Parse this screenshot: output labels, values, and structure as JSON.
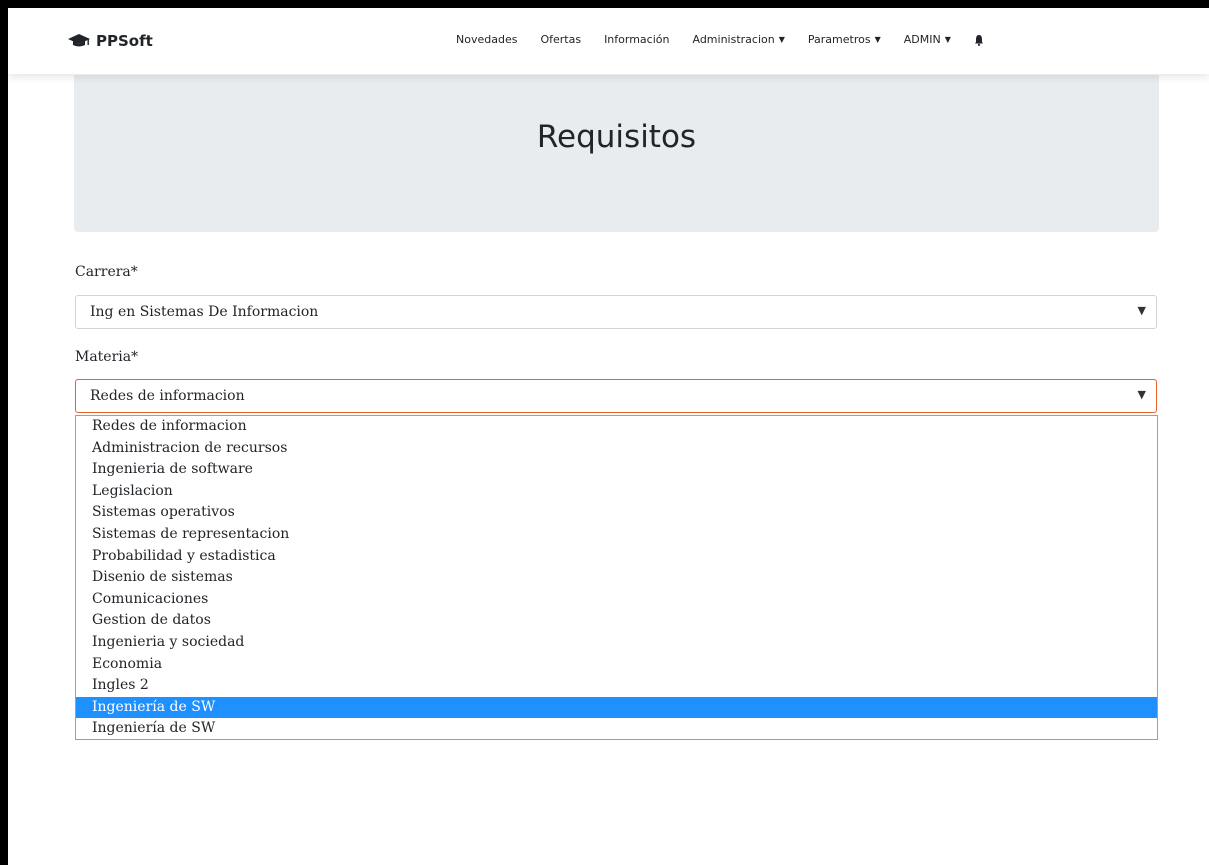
{
  "navbar": {
    "brand": "PPSoft",
    "items": [
      {
        "label": "Novedades",
        "dropdown": false
      },
      {
        "label": "Ofertas",
        "dropdown": false
      },
      {
        "label": "Información",
        "dropdown": false
      },
      {
        "label": "Administracion",
        "dropdown": true
      },
      {
        "label": "Parametros",
        "dropdown": true
      },
      {
        "label": "ADMIN",
        "dropdown": true
      }
    ],
    "icons": [
      "graduation-cap-icon",
      "bell-icon"
    ]
  },
  "hero": {
    "title": "Requisitos"
  },
  "form": {
    "carrera_label": "Carrera*",
    "carrera_value": "Ing en Sistemas De Informacion",
    "materia_label": "Materia*",
    "materia_value": "Redes de informacion",
    "materia_options": [
      "Redes de informacion",
      "Administracion de recursos",
      "Ingenieria de software",
      "Legislacion",
      "Sistemas operativos",
      "Sistemas de representacion",
      "Probabilidad y estadistica",
      "Disenio de sistemas",
      "Comunicaciones",
      "Gestion de datos",
      "Ingenieria y sociedad",
      "Economia",
      "Ingles 2",
      "Ingeniería de SW",
      "Ingeniería de SW"
    ],
    "highlighted_option_index": 13
  },
  "colors": {
    "accent_focus": "#e8632b",
    "highlight": "#1e90ff",
    "hero_bg": "#e9ecef"
  }
}
